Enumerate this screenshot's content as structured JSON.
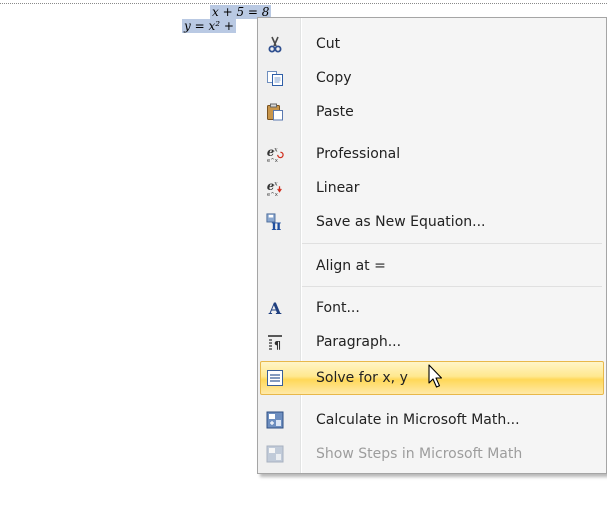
{
  "equation": {
    "line1": "x + 5 = 8",
    "line2": "y = x² +"
  },
  "menu": {
    "items": [
      {
        "icon": "scissors-icon",
        "label": "Cut",
        "enabled": true
      },
      {
        "icon": "copy-icon",
        "label": "Copy",
        "enabled": true
      },
      {
        "icon": "paste-icon",
        "label": "Paste",
        "enabled": true
      },
      {
        "icon": "professional-format-icon",
        "label": "Professional",
        "enabled": true
      },
      {
        "icon": "linear-format-icon",
        "label": "Linear",
        "enabled": true
      },
      {
        "icon": "save-equation-icon",
        "label": "Save as New Equation...",
        "enabled": true
      },
      {
        "icon": "",
        "label": "Align at =",
        "enabled": true
      },
      {
        "icon": "font-icon",
        "label": "Font...",
        "enabled": true
      },
      {
        "icon": "paragraph-icon",
        "label": "Paragraph...",
        "enabled": true
      },
      {
        "icon": "solve-icon",
        "label": "Solve for x, y",
        "enabled": true,
        "highlighted": true
      },
      {
        "icon": "math-calculate-icon",
        "label": "Calculate in Microsoft Math...",
        "enabled": true
      },
      {
        "icon": "math-steps-icon",
        "label": "Show Steps in Microsoft Math",
        "enabled": false
      }
    ]
  },
  "icon_glyphs": {
    "font": "A",
    "professional": "e",
    "linear": "e"
  },
  "colors": {
    "highlight_border": "#e8b84a",
    "selection": "#b9c9e3",
    "disabled_text": "#9d9d9d"
  }
}
